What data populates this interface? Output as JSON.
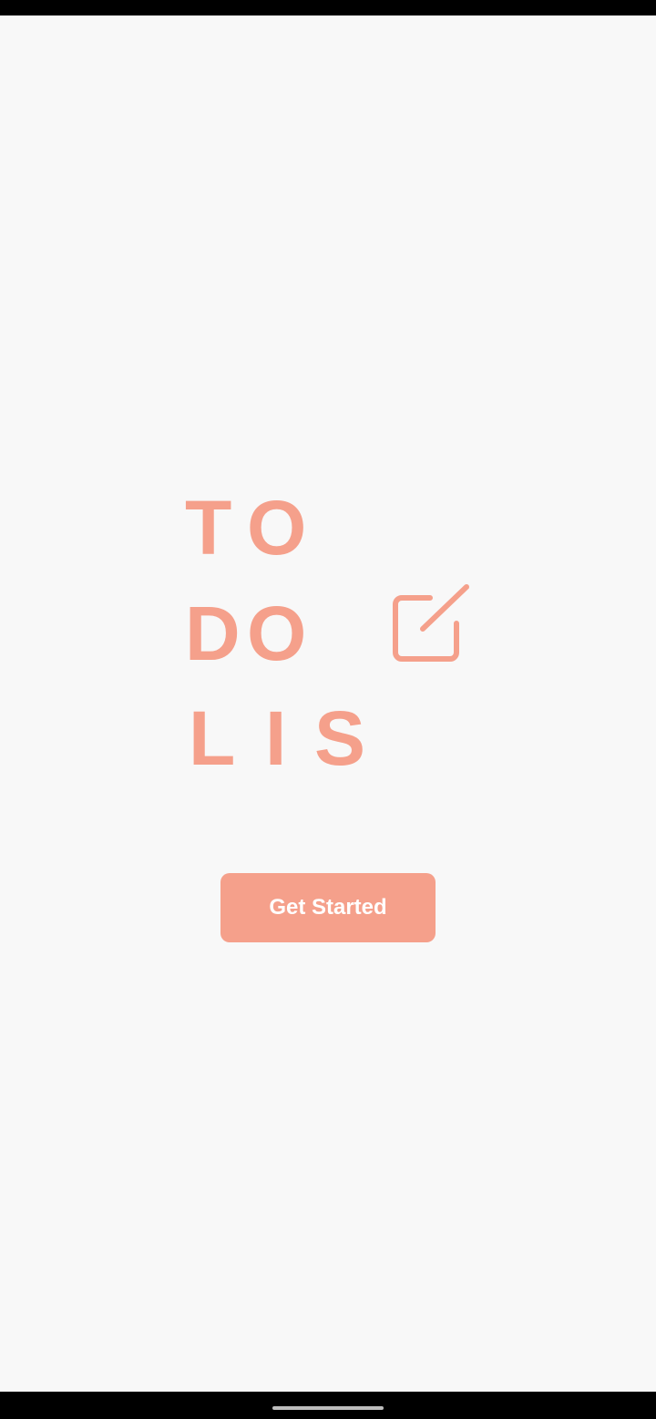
{
  "logo": {
    "row1": [
      "T",
      "O"
    ],
    "row2": [
      "D",
      "O"
    ],
    "row3": [
      "L",
      "I",
      "S"
    ],
    "icon": "edit-square-icon",
    "color": "#f5a08b"
  },
  "actions": {
    "get_started_label": "Get Started",
    "button_color": "#f5a08b",
    "button_text_color": "#ffffff"
  },
  "background_color": "#f8f8f8"
}
